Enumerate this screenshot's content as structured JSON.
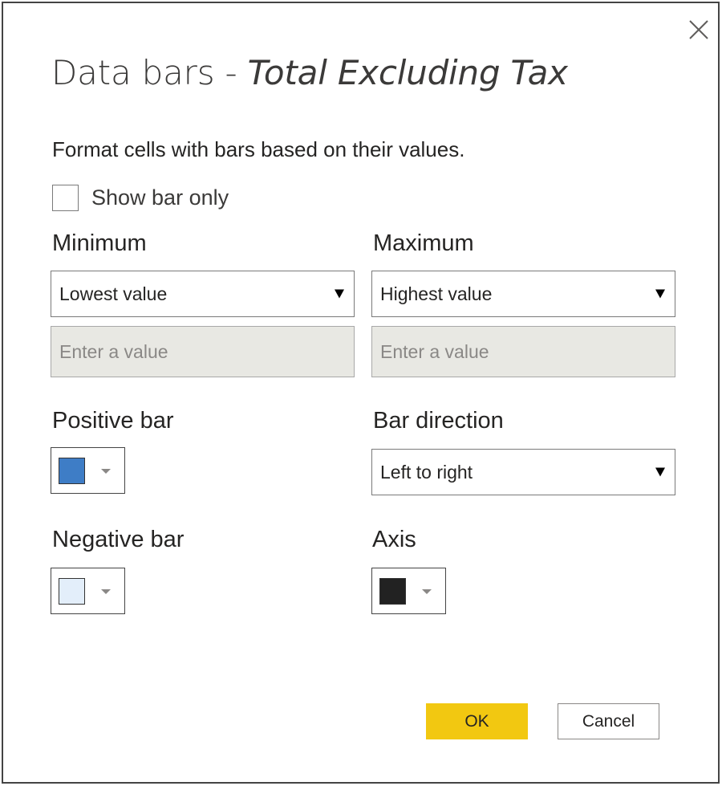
{
  "dialog": {
    "title_prefix": "Data bars - ",
    "title_field": "Total Excluding Tax",
    "description": "Format cells with bars based on their values.",
    "show_bar_only_label": "Show bar only"
  },
  "minimum": {
    "label": "Minimum",
    "selected": "Lowest value",
    "value_placeholder": "Enter a value"
  },
  "maximum": {
    "label": "Maximum",
    "selected": "Highest value",
    "value_placeholder": "Enter a value"
  },
  "positive_bar": {
    "label": "Positive bar",
    "color": "#3e7dc6"
  },
  "negative_bar": {
    "label": "Negative bar",
    "color": "#e3eefa"
  },
  "bar_direction": {
    "label": "Bar direction",
    "selected": "Left to right"
  },
  "axis": {
    "label": "Axis",
    "color": "#222222"
  },
  "buttons": {
    "ok": "OK",
    "cancel": "Cancel"
  }
}
